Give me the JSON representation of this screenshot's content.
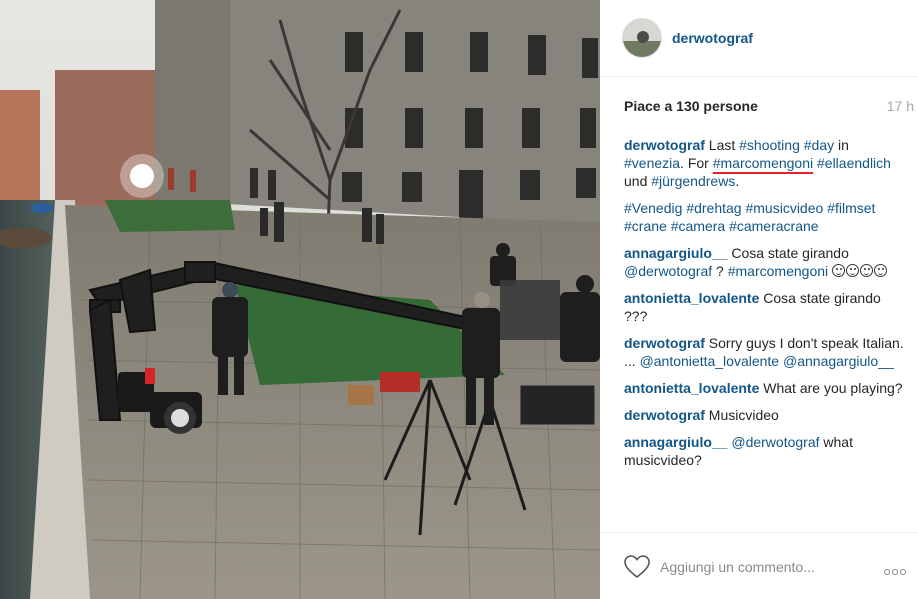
{
  "post": {
    "username": "derwotograf",
    "likes": "Piace a 130 persone",
    "time_ago": "17 h"
  },
  "caption": {
    "user": "derwotograf",
    "parts": [
      {
        "text": "Last ",
        "tag": false
      },
      {
        "text": "#shooting",
        "tag": true
      },
      {
        "text": " ",
        "tag": false
      },
      {
        "text": "#day",
        "tag": true
      },
      {
        "text": " in ",
        "tag": false
      },
      {
        "text": "#venezia",
        "tag": true
      },
      {
        "text": ". ",
        "tag": false
      },
      {
        "text": "For ",
        "tag": false
      },
      {
        "text": "#marcomengoni",
        "tag": true,
        "underline": true
      },
      {
        "text": " ",
        "tag": false
      },
      {
        "text": "#ellaendlich",
        "tag": true
      },
      {
        "text": " und ",
        "tag": false
      },
      {
        "text": "#jürgendrews",
        "tag": true
      },
      {
        "text": ".",
        "tag": false
      }
    ]
  },
  "hashtags": [
    "#Venedig",
    "#drehtag",
    "#musicvideo",
    "#filmset",
    "#crane",
    "#camera",
    "#cameracrane"
  ],
  "comments": [
    {
      "user": "annagargiulo__",
      "parts": [
        {
          "text": "Cosa state girando ",
          "tag": false
        },
        {
          "text": "@derwotograf",
          "tag": true
        },
        {
          "text": " ? ",
          "tag": false
        },
        {
          "text": "#marcomengoni",
          "tag": true
        },
        {
          "text": " ",
          "tag": false
        }
      ],
      "emoji_count": 4
    },
    {
      "user": "antonietta_lovalente",
      "parts": [
        {
          "text": "Cosa state girando ???",
          "tag": false
        }
      ],
      "emoji_count": 0
    },
    {
      "user": "derwotograf",
      "parts": [
        {
          "text": "Sorry guys I don't speak Italian. ... ",
          "tag": false
        },
        {
          "text": "@antonietta_lovalente",
          "tag": true
        },
        {
          "text": " ",
          "tag": false
        },
        {
          "text": "@annagargiulo__",
          "tag": true
        }
      ],
      "emoji_count": 0
    },
    {
      "user": "antonietta_lovalente",
      "parts": [
        {
          "text": "What are you playing?",
          "tag": false
        }
      ],
      "emoji_count": 0
    },
    {
      "user": "derwotograf",
      "parts": [
        {
          "text": "Musicvideo",
          "tag": false
        }
      ],
      "emoji_count": 0
    },
    {
      "user": "annagargiulo__",
      "parts": [
        {
          "text": "@derwotograf",
          "tag": true
        },
        {
          "text": " what musicvideo?",
          "tag": false
        }
      ],
      "emoji_count": 0
    }
  ],
  "footer": {
    "comment_placeholder": "Aggiungi un commento..."
  },
  "icons": {
    "like": "heart-outline-icon",
    "more": "more-options-icon"
  },
  "colors": {
    "link": "#125688",
    "text": "#262626",
    "muted": "#a5a7aa",
    "underline": "#e0242a"
  }
}
